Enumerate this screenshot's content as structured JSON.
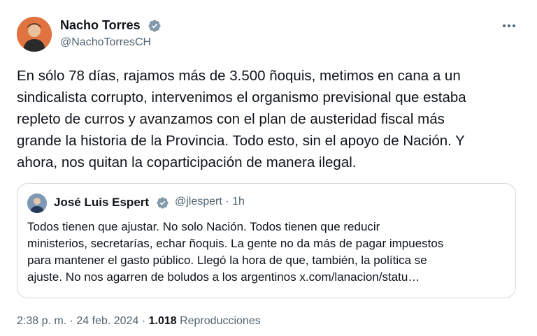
{
  "author": {
    "display_name": "Nacho Torres",
    "handle": "@NachoTorresCH"
  },
  "tweet": {
    "text": "En sólo 78 días, rajamos más de 3.500 ñoquis, metimos en cana a un\nsindicalista corrupto, intervenimos el organismo previsional que estaba\nrepleto de curros y avanzamos con el plan de austeridad fiscal más\ngrande la historia de la Provincia. Todo esto, sin el apoyo de Nación. Y\nahora, nos quitan la coparticipación de manera ilegal."
  },
  "quoted_tweet": {
    "display_name": "José Luis Espert",
    "handle": "@jlespert",
    "separator": "·",
    "time_ago": "1h",
    "text": "Todos tienen que ajustar. No solo Nación. Todos tienen que reducir\nministerios, secretarías, echar ñoquis. La gente no da más de pagar impuestos\npara mantener el gasto público. Llegó la hora de que, también, la política se\najuste. No nos agarren de boludos a los argentinos x.com/lanacion/statu…"
  },
  "footer": {
    "time": "2:38 p. m.",
    "separator": "·",
    "date": "24 feb. 2024",
    "views_count": "1.018",
    "views_label": "Reproducciones"
  },
  "icons": {
    "verified": "verified-badge-icon",
    "more": "more-horizontal-icon"
  },
  "colors": {
    "text_primary": "#0f1419",
    "text_secondary": "#536471",
    "border": "#cfd9de",
    "verified_badge": "#829aab"
  }
}
